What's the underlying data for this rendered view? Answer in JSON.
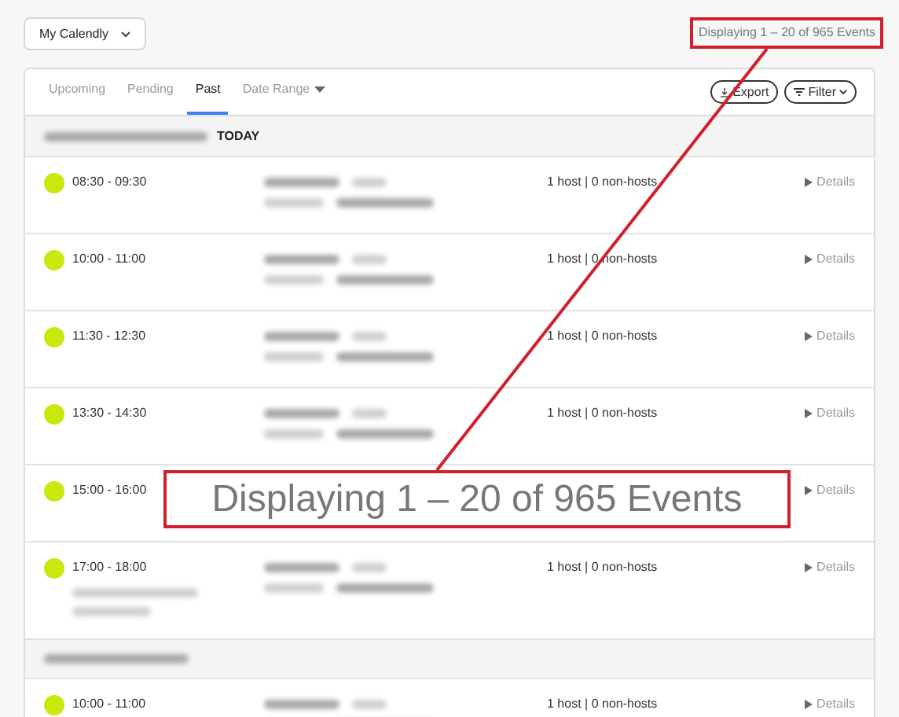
{
  "calendar_menu": {
    "label": "My Calendly"
  },
  "event_count": "Displaying 1 – 20 of 965 Events",
  "tabs": [
    {
      "label": "Upcoming",
      "selected": false
    },
    {
      "label": "Pending",
      "selected": false
    },
    {
      "label": "Past",
      "selected": true
    },
    {
      "label": "Date Range",
      "selected": false
    }
  ],
  "actions": {
    "export": "Export",
    "filter": "Filter"
  },
  "groups": [
    {
      "badge": "TODAY",
      "events": [
        {
          "time": "08:30 - 09:30",
          "attendees": "1 host | 0 non-hosts",
          "details": "Details",
          "extra_note": false
        },
        {
          "time": "10:00 - 11:00",
          "attendees": "1 host | 0 non-hosts",
          "details": "Details",
          "extra_note": false
        },
        {
          "time": "11:30 - 12:30",
          "attendees": "1 host | 0 non-hosts",
          "details": "Details",
          "extra_note": false
        },
        {
          "time": "13:30 - 14:30",
          "attendees": "1 host | 0 non-hosts",
          "details": "Details",
          "extra_note": false
        },
        {
          "time": "15:00 - 16:00",
          "details": "Details",
          "extra_note": false
        },
        {
          "time": "17:00 - 18:00",
          "attendees": "1 host | 0 non-hosts",
          "details": "Details",
          "extra_note": true
        }
      ]
    },
    {
      "events": [
        {
          "time": "10:00 - 11:00",
          "attendees": "1 host | 0 non-hosts",
          "details": "Details",
          "extra_note": false
        }
      ]
    }
  ],
  "annotation": {
    "callout": "Displaying 1 – 20 of 965 Events"
  }
}
